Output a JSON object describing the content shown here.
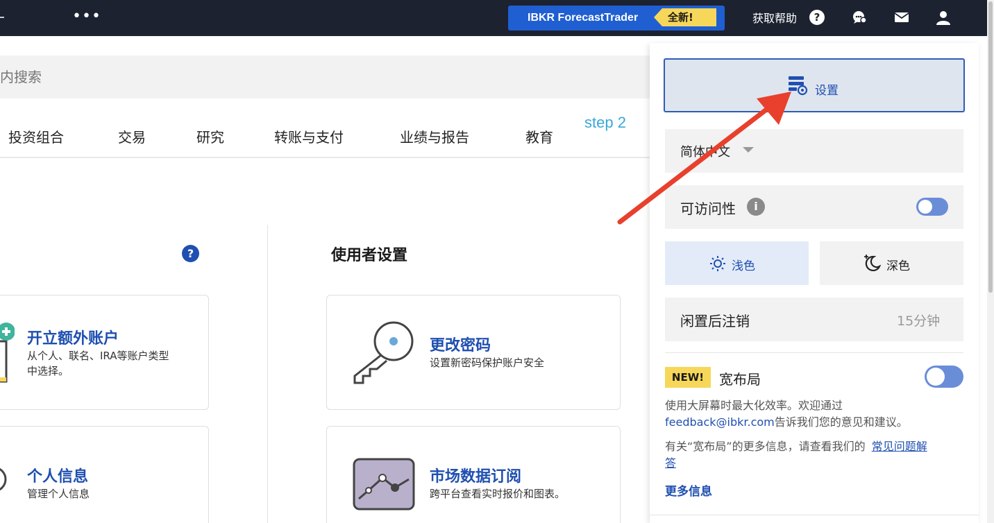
{
  "topbar": {
    "dots": "•••",
    "promo_text": "IBKR ForecastTrader",
    "promo_badge": "全新!",
    "help_label": "获取帮助",
    "help_q": "?"
  },
  "search": {
    "placeholder": "内搜索"
  },
  "nav": {
    "items": [
      "投资组合",
      "交易",
      "研究",
      "转账与支付",
      "业绩与报告",
      "教育"
    ]
  },
  "annotation": {
    "step": "step 2"
  },
  "content": {
    "help_q": "?",
    "section_title": "使用者设置",
    "cards": [
      {
        "title": "开立额外账户",
        "desc_line1": "从个人、联名、IRA等账户类型",
        "desc_line2": "中选择。"
      },
      {
        "title": "更改密码",
        "desc_line1": "设置新密码保护账户安全"
      },
      {
        "title": "个人信息",
        "desc_line1": "管理个人信息"
      },
      {
        "title": "市场数据订阅",
        "desc_line1": "跨平台查看实时报价和图表。"
      }
    ]
  },
  "panel": {
    "settings_label": "设置",
    "language": "简体中文",
    "accessibility_label": "可访问性",
    "info_i": "i",
    "accessibility_on": false,
    "theme_light": "浅色",
    "theme_dark": "深色",
    "idle_label": "闲置后注销",
    "idle_value": "15分钟",
    "new_badge": "NEW!",
    "wide_layout_label": "宽布局",
    "wide_layout_on": false,
    "desc_line1": "使用大屏幕时最大化效率。欢迎通过",
    "feedback_email": "feedback@ibkr.com",
    "desc_line2_rest": "告诉我们您的意见和建议。",
    "more_line1": "有关“宽布局”的更多信息，请查看我们的",
    "faq_part1": "常见问题解",
    "faq_part2": "答",
    "more_info": "更多信息"
  },
  "colors": {
    "topbar_bg": "#1c2230",
    "promo_bg": "#1f5fd1",
    "badge_yellow": "#f6d75a",
    "brand_blue": "#1f4fb0",
    "arrow_red": "#e8402c",
    "toggle_blue": "#6a8dd8"
  }
}
